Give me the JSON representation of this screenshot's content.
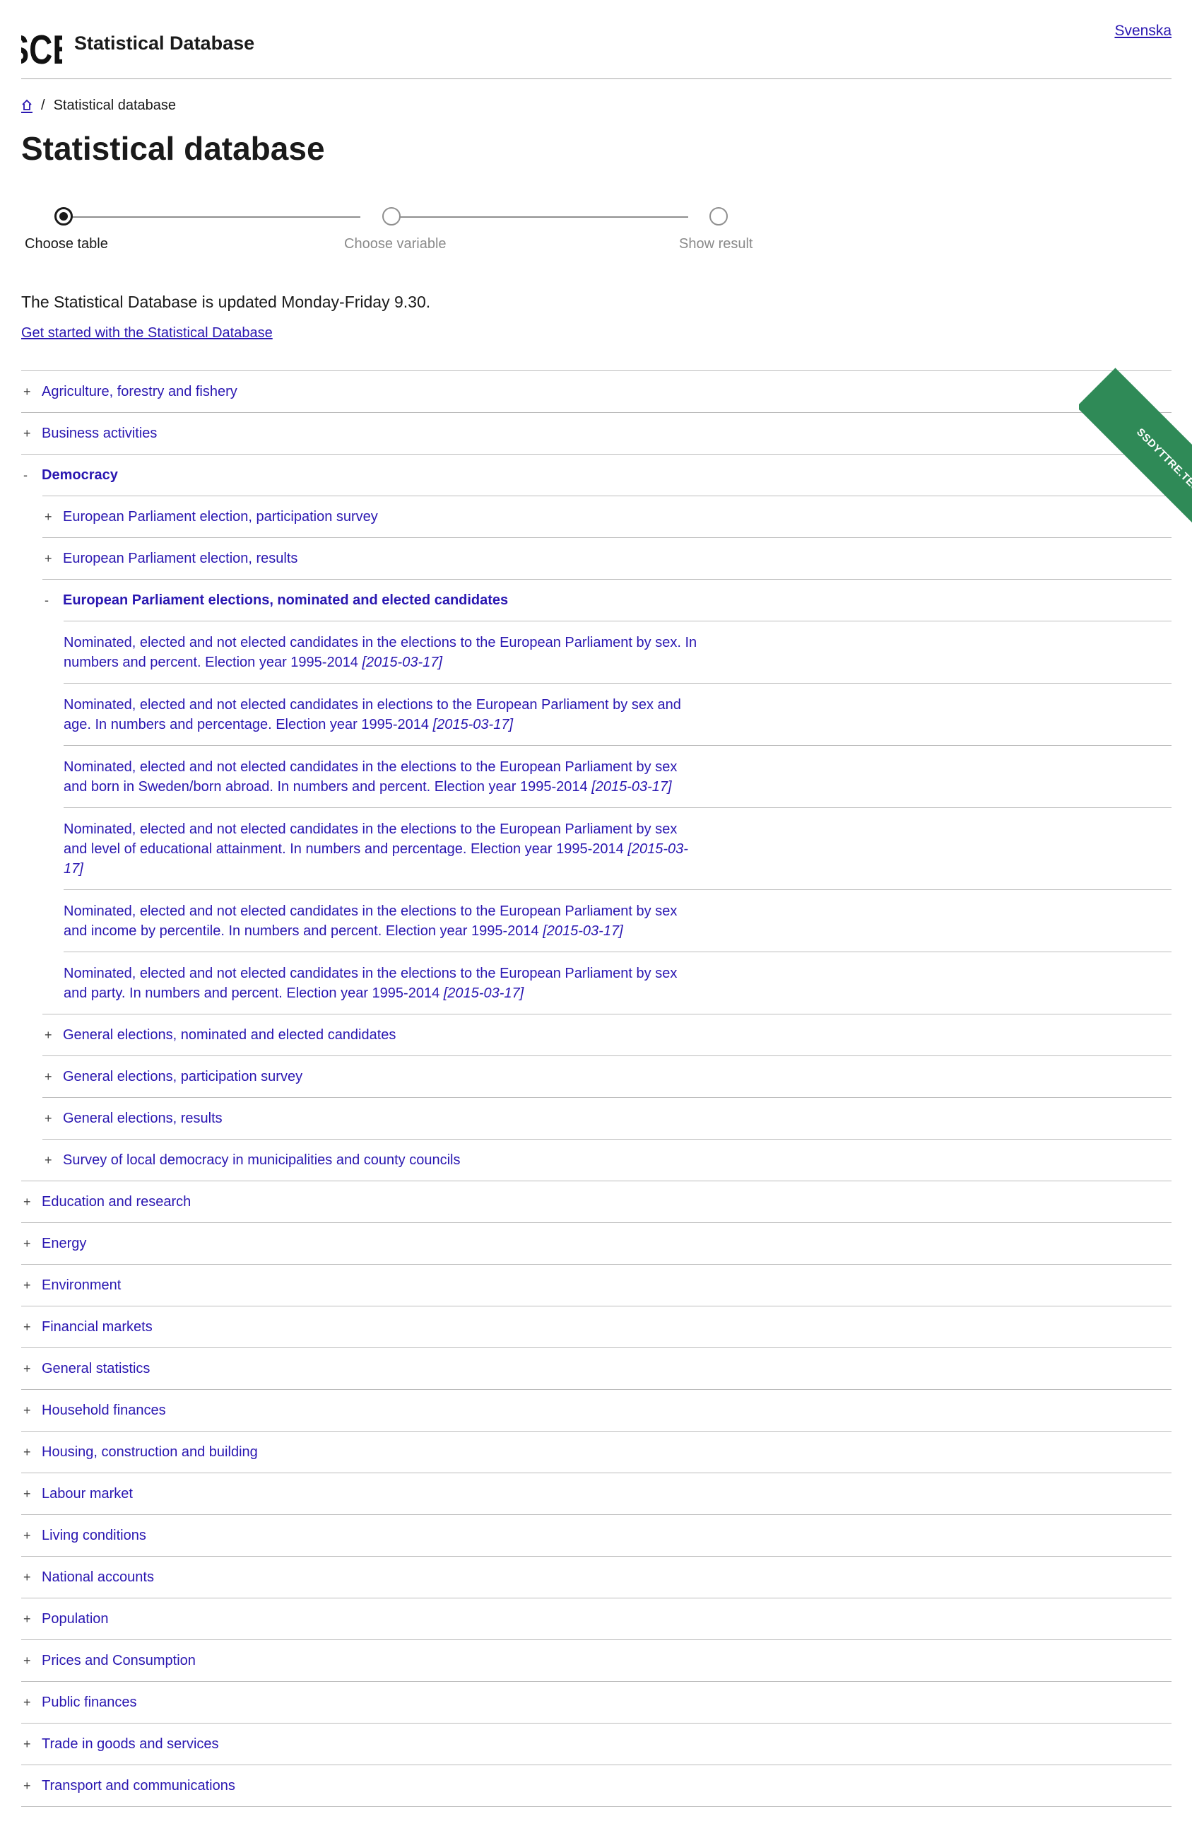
{
  "header": {
    "logo_text": "SCB",
    "title": "Statistical Database",
    "language_link": "Svenska"
  },
  "breadcrumb": {
    "separator": "/",
    "current": "Statistical database"
  },
  "page_title": "Statistical database",
  "stepper": {
    "steps": [
      {
        "label": "Choose table",
        "active": true
      },
      {
        "label": "Choose variable",
        "active": false
      },
      {
        "label": "Show result",
        "active": false
      }
    ]
  },
  "notice": "The Statistical Database is updated Monday-Friday 9.30.",
  "get_started_link": "Get started with the Statistical Database",
  "ribbon": "SSDYTTRE.TEST",
  "icons": {
    "home": "home-icon",
    "expand": "plus-icon",
    "collapse": "minus-icon"
  },
  "colors": {
    "link": "#2a17b1",
    "ribbon": "#2f8a57",
    "divider": "#bcbcbc"
  },
  "tree": {
    "expanded_symbol": "-",
    "collapsed_symbol": "+",
    "top": [
      {
        "label": "Agriculture, forestry and fishery"
      },
      {
        "label": "Business activities"
      },
      {
        "label": "Democracy"
      },
      {
        "label": "Education and research"
      },
      {
        "label": "Energy"
      },
      {
        "label": "Environment"
      },
      {
        "label": "Financial markets"
      },
      {
        "label": "General statistics"
      },
      {
        "label": "Household finances"
      },
      {
        "label": "Housing, construction and building"
      },
      {
        "label": "Labour market"
      },
      {
        "label": "Living conditions"
      },
      {
        "label": "National accounts"
      },
      {
        "label": "Population"
      },
      {
        "label": "Prices and Consumption"
      },
      {
        "label": "Public finances"
      },
      {
        "label": "Trade in goods and services"
      },
      {
        "label": "Transport and communications"
      }
    ],
    "democracy_children": [
      {
        "label": "European Parliament election, participation survey"
      },
      {
        "label": "European Parliament election, results"
      },
      {
        "label": "European Parliament elections, nominated and elected candidates"
      },
      {
        "label": "General elections, nominated and elected candidates"
      },
      {
        "label": "General elections, participation survey"
      },
      {
        "label": "General elections, results"
      },
      {
        "label": "Survey of local democracy in municipalities and county councils"
      }
    ],
    "tables": [
      {
        "text": "Nominated, elected and not elected candidates in the elections to the European Parliament by sex. In numbers and percent. Election year 1995-2014",
        "date": "[2015-03-17]"
      },
      {
        "text": "Nominated, elected and not elected candidates in elections to the European Parliament by sex and age. In numbers and percentage. Election year 1995-2014",
        "date": "[2015-03-17]"
      },
      {
        "text": "Nominated, elected and not elected candidates in the elections to the European Parliament by sex and born in Sweden/born abroad. In numbers and percent. Election year 1995-2014",
        "date": "[2015-03-17]"
      },
      {
        "text": "Nominated, elected and not elected candidates in the elections to the European Parliament by sex and level of educational attainment. In numbers and percentage. Election year 1995-2014",
        "date": "[2015-03-17]"
      },
      {
        "text": "Nominated, elected and not elected candidates in the elections to the European Parliament by sex and income by percentile. In numbers and percent. Election year 1995-2014",
        "date": "[2015-03-17]"
      },
      {
        "text": "Nominated, elected and not elected candidates in the elections to the European Parliament by sex and party. In numbers and percent. Election year 1995-2014",
        "date": "[2015-03-17]"
      }
    ]
  }
}
